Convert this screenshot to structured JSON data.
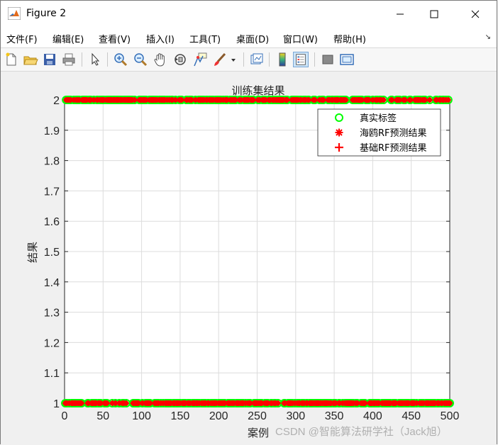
{
  "window": {
    "title": "Figure 2",
    "minimize_glyph": "—",
    "maximize_glyph": "☐",
    "close_glyph": "✕"
  },
  "menu": {
    "items": [
      "文件(F)",
      "编辑(E)",
      "查看(V)",
      "插入(I)",
      "工具(T)",
      "桌面(D)",
      "窗口(W)",
      "帮助(H)"
    ],
    "overflow_glyph": "↘"
  },
  "toolbar": {
    "icons": [
      "new-figure-icon",
      "open-file-icon",
      "save-icon",
      "print-icon",
      "pointer-icon",
      "zoom-in-icon",
      "zoom-out-icon",
      "pan-hand-icon",
      "rotate-3d-icon",
      "data-cursor-icon",
      "brush-icon",
      "dropdown-arrow-icon",
      "link-plot-icon",
      "colorbar-icon",
      "legend-icon",
      "hide-plot-tools-icon",
      "show-plot-tools-icon"
    ]
  },
  "colors": {
    "true_label": "#00ff00",
    "seagull_rf": "#ff0000",
    "base_rf": "#ff0000",
    "grid": "#dcdcdc"
  },
  "chart_data": {
    "type": "scatter",
    "title": "训练集结果",
    "xlabel": "案例",
    "ylabel": "结果",
    "xlim": [
      0,
      500
    ],
    "ylim": [
      1,
      2
    ],
    "xticks": [
      "0",
      "50",
      "100",
      "150",
      "200",
      "250",
      "300",
      "350",
      "400",
      "450",
      "500"
    ],
    "yticks": [
      "1",
      "1.1",
      "1.2",
      "1.3",
      "1.4",
      "1.5",
      "1.6",
      "1.7",
      "1.8",
      "1.9",
      "2"
    ],
    "grid": true,
    "legend_position": "top-right",
    "series": [
      {
        "name": "真实标签",
        "marker": "o",
        "color": "#00ff00",
        "note": "all cases at value 1 or 2"
      },
      {
        "name": "海鸥RF预测结果",
        "marker": "*",
        "color": "#ff0000"
      },
      {
        "name": "基础RF预测结果",
        "marker": "+",
        "color": "#ff0000"
      }
    ],
    "x_range_points": [
      1,
      500
    ],
    "values_observed": [
      1,
      2
    ],
    "value2_gaps": [
      [
        223,
        226
      ],
      [
        367,
        371
      ],
      [
        419,
        423
      ],
      [
        477,
        480
      ]
    ],
    "value1_gaps": []
  },
  "watermark": "CSDN @智能算法研学社（Jack旭）"
}
